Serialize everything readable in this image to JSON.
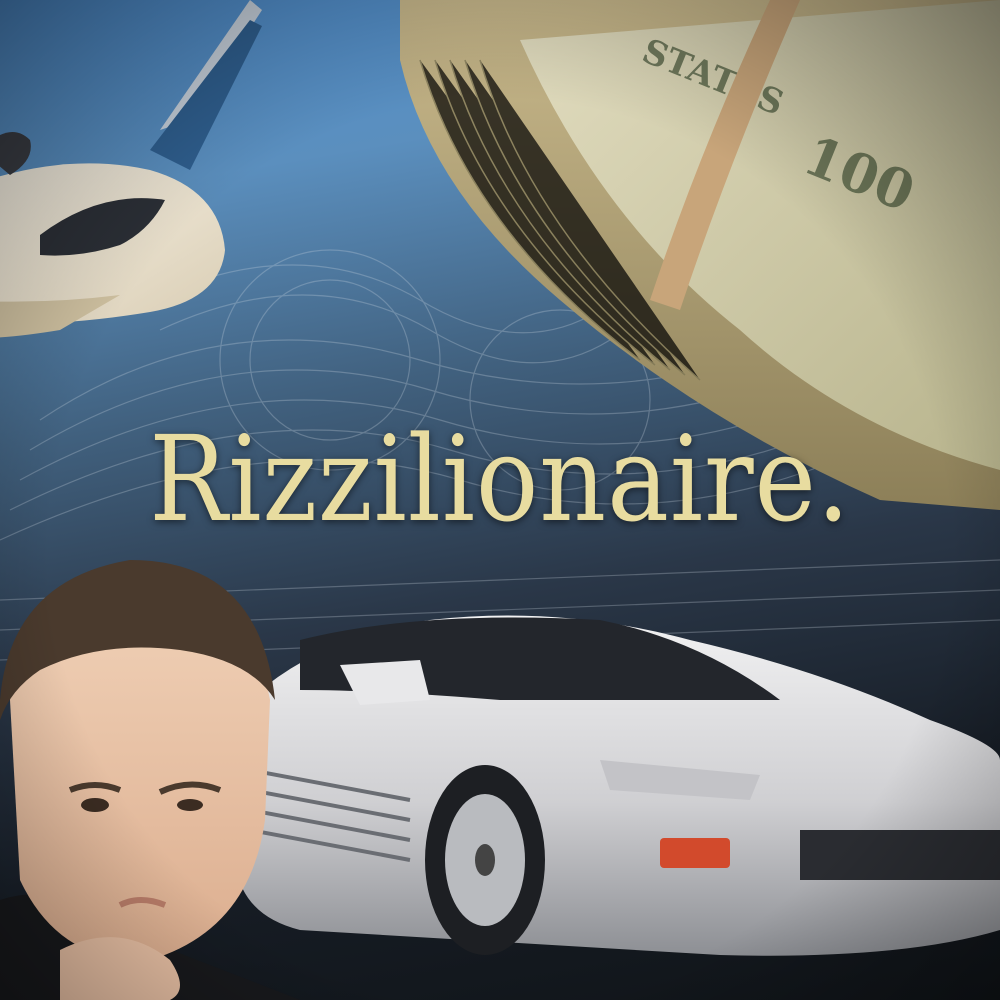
{
  "poster": {
    "title": "Rizzilionaire."
  },
  "palette": {
    "title_color": "#e8dca0",
    "sky_blue": "#4f8fd0",
    "bill_green": "#c9c7a0",
    "car_silver": "#d9d9db",
    "band_tan": "#c8a57a"
  },
  "icons": {
    "jet": "private-jet-illustration",
    "cash": "rolled-cash-illustration",
    "car": "silver-sports-car-illustration",
    "person": "boy-thinking-illustration",
    "engraving": "banknote-engraving-texture"
  }
}
